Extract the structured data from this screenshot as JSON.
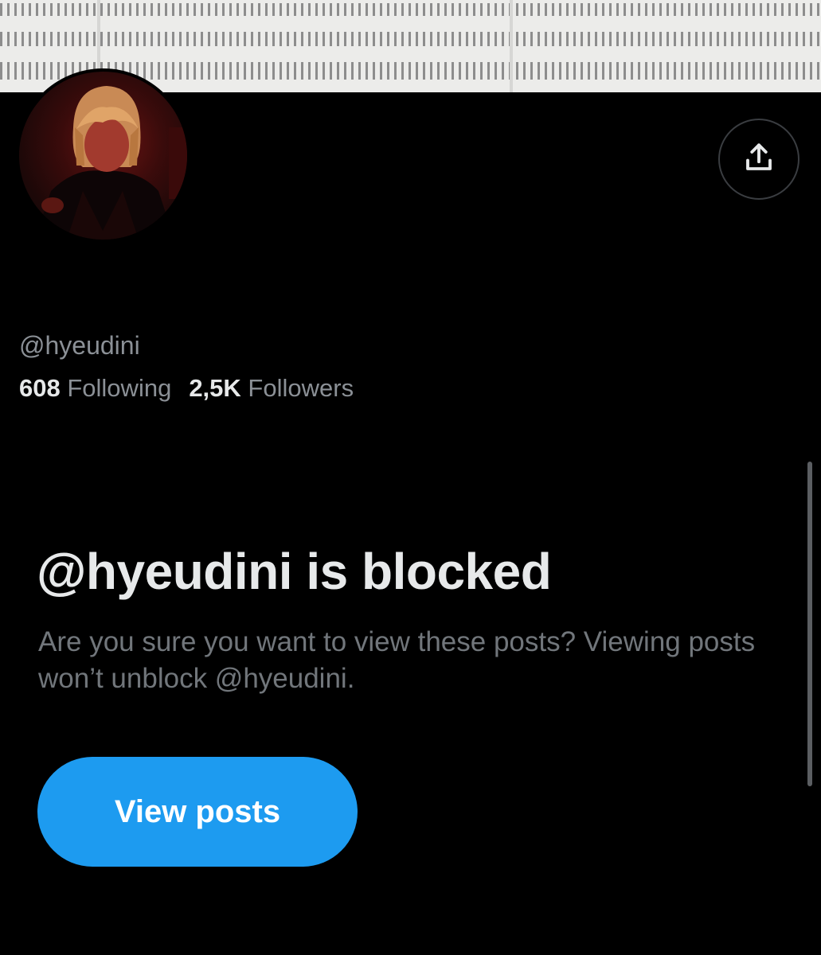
{
  "profile": {
    "handle": "@hyeudini",
    "following_count": "608",
    "following_label": "Following",
    "followers_count": "2,5K",
    "followers_label": "Followers"
  },
  "header": {
    "share_icon": "share-upload-icon"
  },
  "blocked": {
    "title": "@hyeudini is blocked",
    "description": "Are you sure you want to view these posts? Viewing posts won’t unblock @hyeudini.",
    "view_posts_label": "View posts"
  },
  "colors": {
    "background": "#000000",
    "accent": "#1d9bf0",
    "primary_text": "#e7e9ea",
    "secondary_text": "#71767b"
  }
}
